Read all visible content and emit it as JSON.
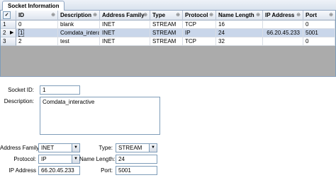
{
  "tab": {
    "label": "Socket Information"
  },
  "grid": {
    "corner_icon": "grid-options-icon",
    "columns": [
      "ID",
      "Description",
      "Address Family",
      "Type",
      "Protocol",
      "Name Length",
      "IP Address",
      "Port"
    ],
    "pin_glyph": "⊕",
    "rows": [
      {
        "row_no": "1",
        "id": "0",
        "description": "blank",
        "family": "INET",
        "type": "STREAM",
        "protocol": "TCP",
        "name_length": "16",
        "ip": "",
        "port": "0"
      },
      {
        "row_no": "2",
        "id": "1",
        "description": "Comdata_intera...",
        "family": "INET",
        "type": "STREAM",
        "protocol": "IP",
        "name_length": "24",
        "ip": "66.20.45.233",
        "port": "5001"
      },
      {
        "row_no": "3",
        "id": "2",
        "description": "test",
        "family": "INET",
        "type": "STREAM",
        "protocol": "TCP",
        "name_length": "32",
        "ip": "",
        "port": "0"
      }
    ]
  },
  "detail": {
    "socket_id_label": "Socket ID:",
    "socket_id_value": "1",
    "description_label": "Description:",
    "description_value": "Comdata_interactive",
    "address_family_label": "Address Family:",
    "address_family_value": "INET",
    "type_label": "Type:",
    "type_value": "STREAM",
    "protocol_label": "Protocol:",
    "protocol_value": "IP",
    "name_length_label": "Name Length:",
    "name_length_value": "24",
    "ip_label": "IP Address",
    "ip_value": "66.20.45.233",
    "port_label": "Port:",
    "port_value": "5001"
  },
  "colors": {
    "selected_row": "#c9d6ea",
    "grid_background": "#ababab",
    "border": "#7f9db9"
  }
}
